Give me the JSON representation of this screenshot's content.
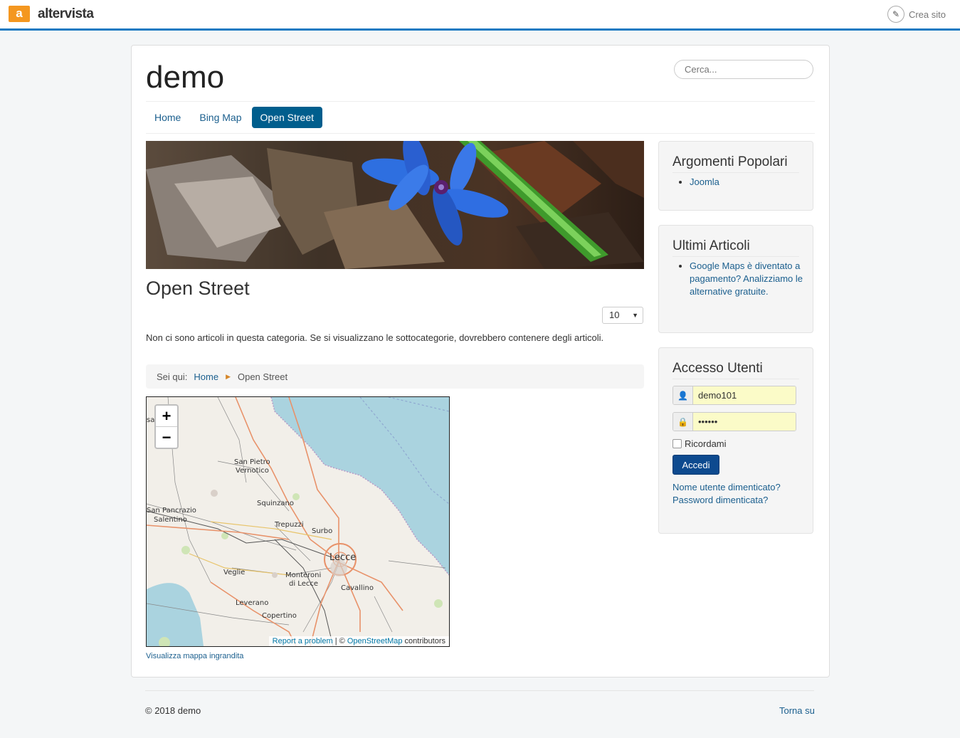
{
  "topbar": {
    "brand_letter": "a",
    "brand": "altervista",
    "crea": "Crea sito"
  },
  "site": {
    "title": "demo",
    "search_placeholder": "Cerca..."
  },
  "nav": [
    {
      "label": "Home"
    },
    {
      "label": "Bing Map"
    },
    {
      "label": "Open Street",
      "active": true
    }
  ],
  "main": {
    "heading": "Open Street",
    "limit_value": "10",
    "no_articles": "Non ci sono articoli in questa categoria. Se si visualizzano le sottocategorie, dovrebbero contenere degli articoli.",
    "breadcrumb": {
      "label": "Sei qui:",
      "home": "Home",
      "current": "Open Street"
    },
    "map": {
      "zoom_in": "+",
      "zoom_out": "−",
      "cities": [
        "San Pietro Vernotico",
        "Squinzano",
        "San Pancrazio Salentino",
        "Trepuzzi",
        "Surbo",
        "Lecce",
        "Veglie",
        "Monteroni di Lecce",
        "Cavallino",
        "Leverano",
        "Copertino"
      ],
      "attribution_report": "Report a problem",
      "attribution_sep": " | © ",
      "attribution_osm": "OpenStreetMap",
      "attribution_tail": " contributors"
    },
    "map_link": "Visualizza mappa ingrandita"
  },
  "sidebar": {
    "popular": {
      "title": "Argomenti Popolari",
      "items": [
        "Joomla"
      ]
    },
    "latest": {
      "title": "Ultimi Articoli",
      "items": [
        "Google Maps è diventato a pagamento? Analizziamo le alternative gratuite."
      ]
    },
    "login": {
      "title": "Accesso Utenti",
      "username": "demo101",
      "password": "••••••",
      "remember": "Ricordami",
      "submit": "Accedi",
      "forgot_user": "Nome utente dimenticato?",
      "forgot_pass": "Password dimenticata?"
    }
  },
  "footer": {
    "copyright": "© 2018 demo",
    "back_to_top": "Torna su"
  },
  "colors": {
    "accent": "#005e8d",
    "topbar_line": "#1b7ac2",
    "brand_orange": "#f49720",
    "button": "#0d4a8f"
  }
}
